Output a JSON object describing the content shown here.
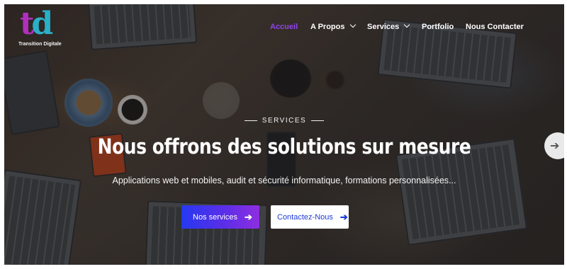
{
  "brand": {
    "mark_t": "t",
    "mark_d": "d",
    "tagline": "Transition Digitale"
  },
  "nav": {
    "items": [
      {
        "label": "Accueil",
        "active": true,
        "dropdown": false
      },
      {
        "label": "A Propos",
        "active": false,
        "dropdown": true
      },
      {
        "label": "Services",
        "active": false,
        "dropdown": true
      },
      {
        "label": "Portfolio",
        "active": false,
        "dropdown": false
      },
      {
        "label": "Nous Contacter",
        "active": false,
        "dropdown": false
      }
    ]
  },
  "hero": {
    "eyebrow": "SERVICES",
    "title": "Nous offrons des solutions sur mesure",
    "subtitle": "Applications web et mobiles, audit et sécurité informatique, formations personnalisées...",
    "primary_button": {
      "label": "Nos services",
      "icon": "arrow-right-icon"
    },
    "secondary_button": {
      "label": "Contactez-Nous",
      "icon": "arrow-right-icon"
    }
  },
  "slider": {
    "next_icon": "arrow-right-icon"
  },
  "colors": {
    "accent": "#8e44e8",
    "primary_start": "#2639f0",
    "primary_end": "#8e2ee0",
    "secondary_text": "#1f3bd8",
    "logo_t": "#b02fbf",
    "logo_d": "#2ab0c8"
  }
}
